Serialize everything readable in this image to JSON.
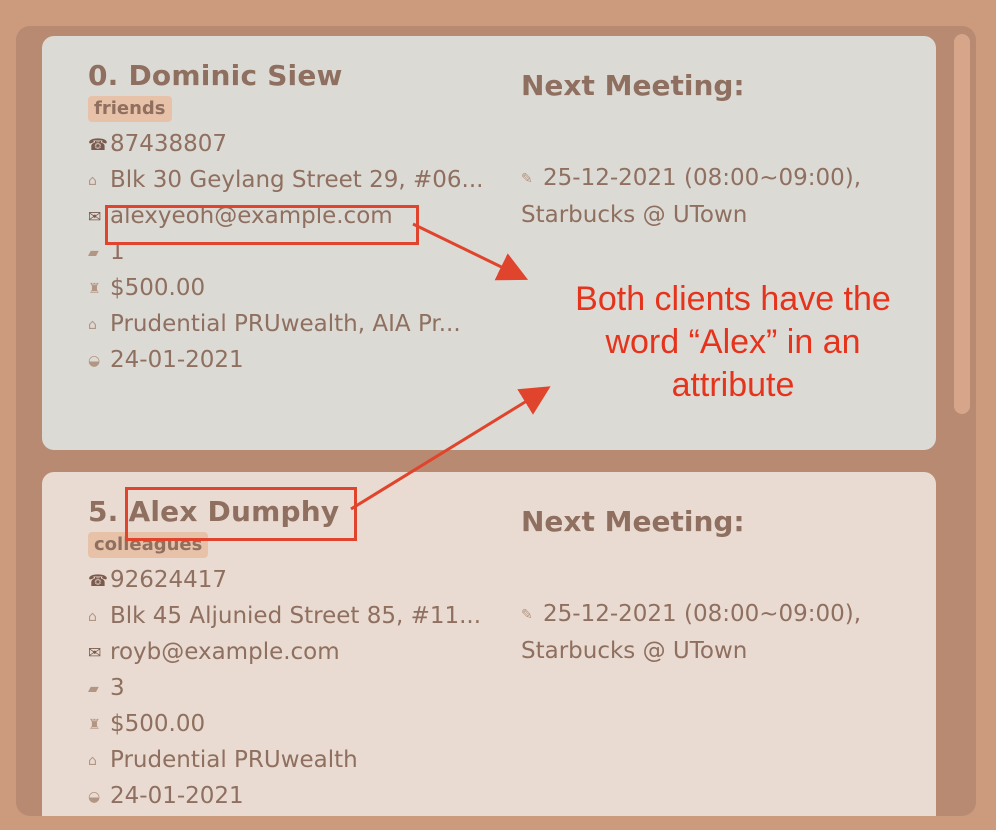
{
  "clients": [
    {
      "name": "0.  Dominic Siew",
      "tag": "friends",
      "phone": "87438807",
      "address": "Blk 30 Geylang Street 29, #06...",
      "email": "alexyeoh@example.com",
      "risk": "1",
      "income": "$500.00",
      "policies": "Prudential PRUwealth, AIA Pr...",
      "last_met": "24-01-2021",
      "next_meeting_label": "Next Meeting:",
      "next_meeting_time": "25-12-2021 (08:00~09:00),",
      "next_meeting_place": "Starbucks @ UTown"
    },
    {
      "name": "5.  Alex Dumphy",
      "tag": "colleagues",
      "phone": "92624417",
      "address": "Blk 45 Aljunied Street 85, #11...",
      "email": "royb@example.com",
      "risk": "3",
      "income": "$500.00",
      "policies": "Prudential PRUwealth",
      "last_met": "24-01-2021",
      "next_meeting_label": "Next Meeting:",
      "next_meeting_time": "25-12-2021 (08:00~09:00),",
      "next_meeting_place": "Starbucks @ UTown"
    }
  ],
  "icons": {
    "phone": "☎",
    "address": "⌂",
    "email": "✉",
    "risk": "▰",
    "income": "♜",
    "policy": "⌂",
    "last_met": "◒",
    "meeting": "✎"
  },
  "annotation": {
    "line1": "Both clients have the",
    "line2": "word “Alex” in an",
    "line3": "attribute"
  },
  "colors": {
    "background": "#cc9a7d",
    "card_selected": "#dcdad5",
    "card": "#e9dbd1",
    "text": "#8f6f5f",
    "highlight": "#e0442c"
  }
}
